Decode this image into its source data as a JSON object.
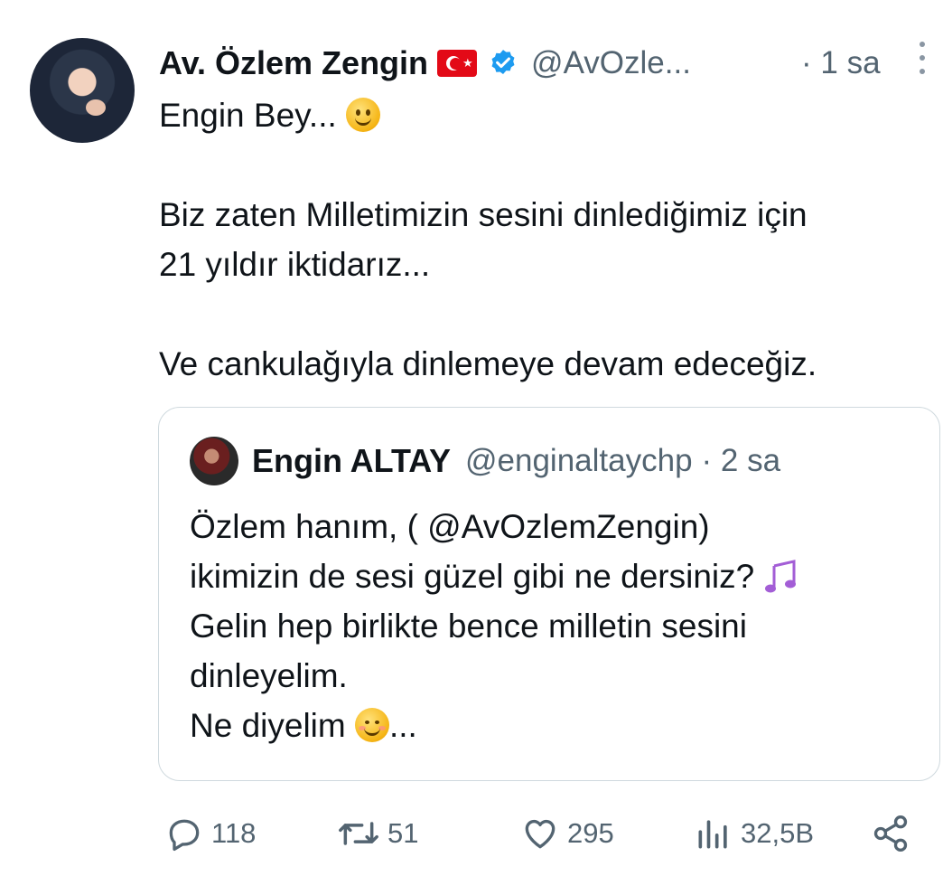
{
  "tweet": {
    "author_name": "Av. Özlem Zengin",
    "handle": "@AvOzle...",
    "time": "· 1 sa",
    "text_lines": [
      "Engin Bey...",
      "",
      "Biz zaten Milletimizin sesini dinlediğimiz için",
      "21 yıldır iktidarız...",
      "",
      "Ve cankulağıyla dinlemeye devam edeceğiz."
    ]
  },
  "quoted_tweet": {
    "author_name": "Engin ALTAY",
    "handle": "@enginaltaychp",
    "time": "· 2 sa",
    "text_lines": [
      "Özlem hanım, ( @AvOzlemZengin)",
      "ikimizin de sesi güzel gibi ne dersiniz?",
      "Gelin hep birlikte bence milletin sesini",
      "dinleyelim.",
      "Ne diyelim"
    ],
    "trailing": "..."
  },
  "actions": {
    "replies": "118",
    "retweets": "51",
    "likes": "295",
    "views": "32,5B"
  },
  "icons": {
    "flag": "turkey-flag-icon",
    "verified": "verified-badge-icon",
    "accent": "#1d9bf0"
  }
}
